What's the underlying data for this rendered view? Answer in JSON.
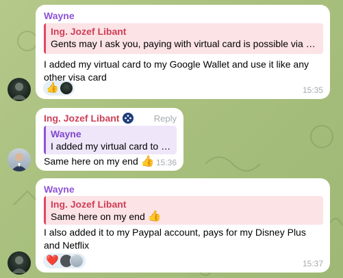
{
  "messages": [
    {
      "sender": "Wayne",
      "reply_to": {
        "name": "Ing. Jozef Libant",
        "text": "Gents may I ask you, paying with virtual card is possible via zypt..."
      },
      "text": "I added my virtual card to my Google Wallet and use it like any other visa card",
      "time": "15:35",
      "reactions": [
        "👍"
      ]
    },
    {
      "sender": "Ing. Jozef Libant",
      "reply_label": "Reply",
      "reply_to": {
        "name": "Wayne",
        "text": "I added my virtual card to m..."
      },
      "text": "Same here on my end",
      "emoji": "👍",
      "time": "15:36"
    },
    {
      "sender": "Wayne",
      "reply_to": {
        "name": "Ing. Jozef Libant",
        "text": "Same here on my end"
      },
      "reply_emoji": "👍",
      "text": "I also added it to my Paypal account, pays for my Disney Plus and Netflix",
      "time": "15:37",
      "reactions": [
        "❤️"
      ]
    }
  ],
  "colors": {
    "wayne_name": "#8c52d6",
    "jozef_name": "#d03d56",
    "background": "#a9c07f"
  }
}
